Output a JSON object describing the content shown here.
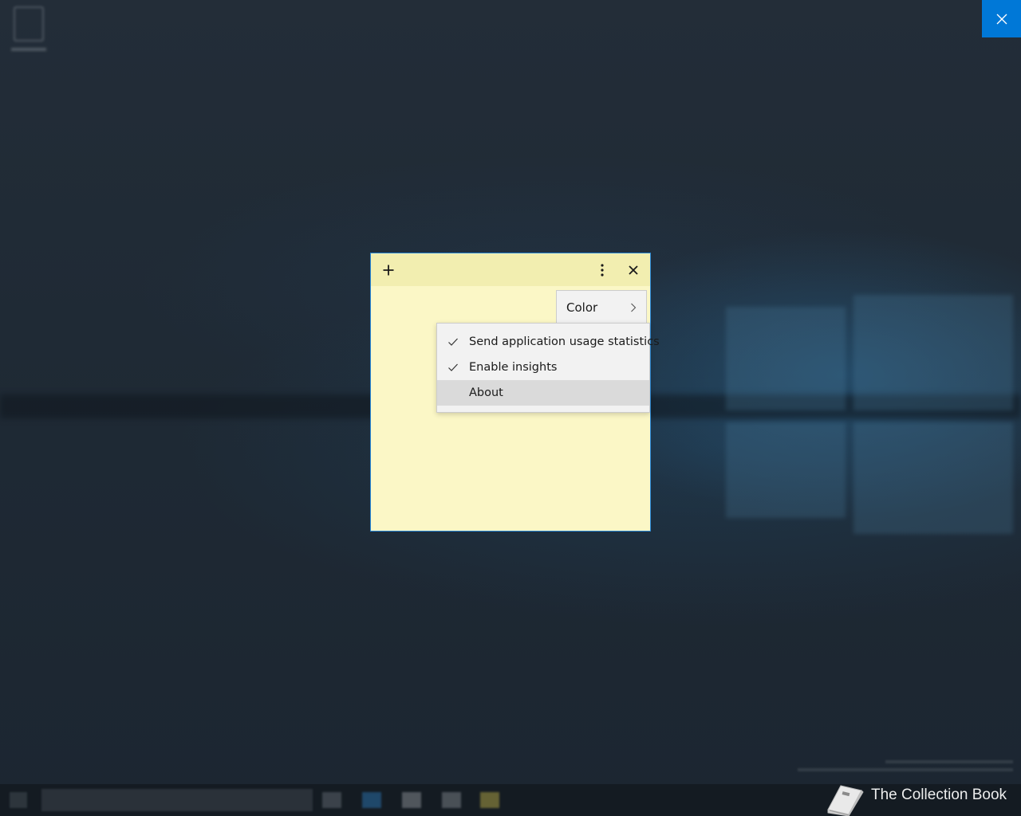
{
  "desktop": {
    "icons": [
      "recycle-bin-icon"
    ]
  },
  "overlay": {
    "close_icon": "close-icon",
    "accent": "#0078d7"
  },
  "note": {
    "background": "#fbf7c6",
    "header_background": "#f2eeb0",
    "toolbar": {
      "add_icon": "plus-icon",
      "menu_icon": "vertical-ellipsis-icon",
      "close_icon": "close-icon"
    },
    "color_item": {
      "label": "Color",
      "icon": "chevron-right-icon"
    }
  },
  "menu": {
    "items": [
      {
        "label": "Send application usage statistics",
        "checked": true
      },
      {
        "label": "Enable insights",
        "checked": true
      },
      {
        "label": "About",
        "checked": false,
        "highlighted": true
      }
    ]
  },
  "brand": {
    "icon": "book-icon",
    "text": "The Collection Book"
  }
}
